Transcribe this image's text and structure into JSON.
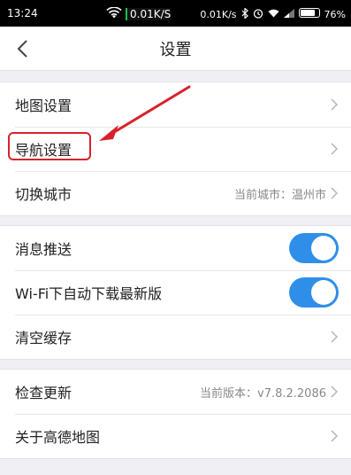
{
  "status_bar": {
    "time": "13:24",
    "speed_primary": "0.01K/S",
    "speed_secondary": "0.01K/s",
    "battery": "76%"
  },
  "nav": {
    "title": "设置"
  },
  "groups": [
    {
      "rows": [
        {
          "label": "地图设置"
        },
        {
          "label": "导航设置"
        },
        {
          "label": "切换城市",
          "value": "当前城市：温州市"
        }
      ]
    },
    {
      "rows": [
        {
          "label": "消息推送",
          "toggle": true
        },
        {
          "label": "Wi-Fi下自动下载最新版",
          "toggle": true
        },
        {
          "label": "清空缓存"
        }
      ]
    },
    {
      "rows": [
        {
          "label": "检查更新",
          "value": "当前版本：v7.8.2.2086"
        },
        {
          "label": "关于高德地图"
        }
      ]
    }
  ],
  "colors": {
    "toggle_on": "#2f8fe8",
    "annotation_red": "#d8222a",
    "background": "#efeff4"
  }
}
